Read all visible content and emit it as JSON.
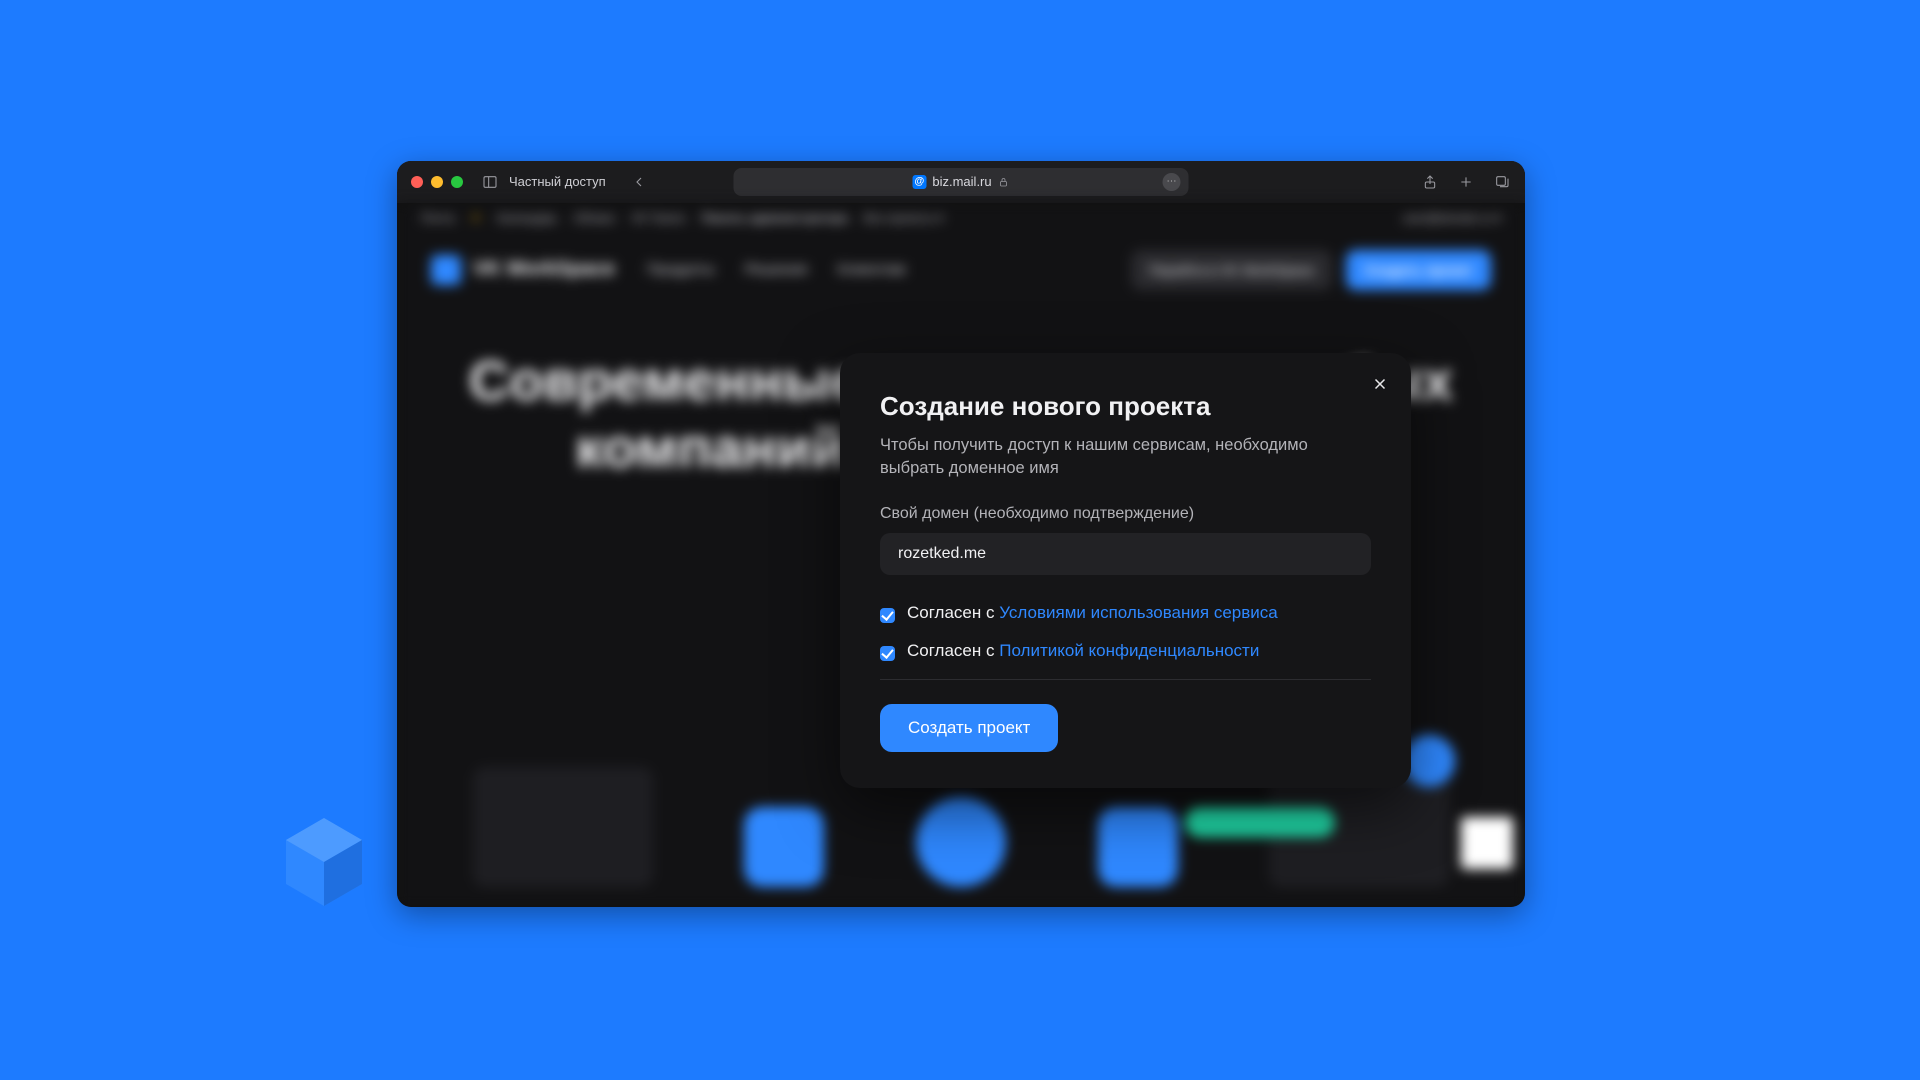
{
  "browser": {
    "private_label": "Частный доступ",
    "url": "biz.mail.ru"
  },
  "bg": {
    "brand": "VK WorkSpace",
    "nav1": "Продукты",
    "nav2": "Решения",
    "nav3": "Клиентам",
    "ghost_btn": "Перейти в VK WorkSpace",
    "primary_btn": "Создать проект",
    "hero_line1": "Современные сервисы для любых",
    "hero_line2": "компаний на вашем домене"
  },
  "modal": {
    "title": "Создание нового проекта",
    "subtitle": "Чтобы получить доступ к нашим сервисам, необходимо выбрать доменное имя",
    "domain_label": "Свой домен (необходимо подтверждение)",
    "domain_value": "rozetked.me",
    "agree_prefix": "Согласен с ",
    "terms_link": "Условиями использования сервиса",
    "privacy_link": "Политикой конфиденциальности",
    "submit": "Создать проект"
  }
}
